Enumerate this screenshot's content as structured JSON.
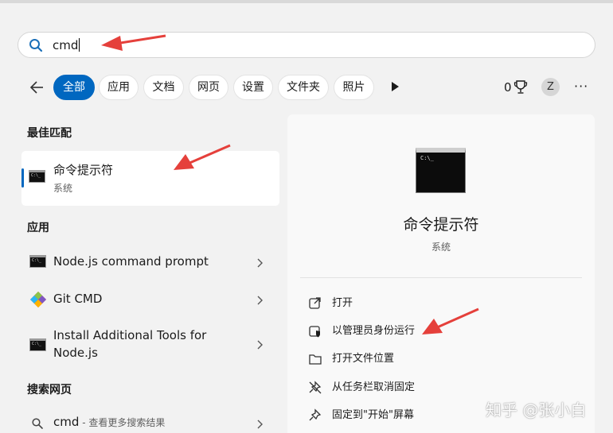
{
  "search": {
    "query": "cmd"
  },
  "filters": {
    "tabs": [
      {
        "label": "全部",
        "active": true
      },
      {
        "label": "应用",
        "active": false
      },
      {
        "label": "文档",
        "active": false
      },
      {
        "label": "网页",
        "active": false
      },
      {
        "label": "设置",
        "active": false
      },
      {
        "label": "文件夹",
        "active": false
      },
      {
        "label": "照片",
        "active": false
      }
    ],
    "points": "0",
    "avatar_initial": "Z",
    "more": "···"
  },
  "best_match": {
    "heading": "最佳匹配",
    "title": "命令提示符",
    "subtitle": "系统"
  },
  "apps": {
    "heading": "应用",
    "items": [
      {
        "label": "Node.js command prompt",
        "icon": "cmd-icon"
      },
      {
        "label": "Git CMD",
        "icon": "git-icon"
      },
      {
        "label": "Install Additional Tools for Node.js",
        "label_line1": "Install Additional Tools for",
        "label_line2": "Node.js",
        "icon": "cmd-icon"
      }
    ]
  },
  "web": {
    "heading": "搜索网页",
    "query": "cmd",
    "hint": " - 查看更多搜索结果"
  },
  "detail": {
    "title": "命令提示符",
    "subtitle": "系统",
    "actions": [
      {
        "label": "打开",
        "icon": "open-icon"
      },
      {
        "label": "以管理员身份运行",
        "icon": "shield-icon"
      },
      {
        "label": "打开文件位置",
        "icon": "folder-icon"
      },
      {
        "label": "从任务栏取消固定",
        "icon": "unpin-icon"
      },
      {
        "label": "固定到\"开始\"屏幕",
        "icon": "pin-icon"
      }
    ]
  },
  "watermark": "知乎 @张小白",
  "colors": {
    "accent": "#0067c0",
    "arrow": "#e5403b",
    "background": "#f2f2f2",
    "panel": "#f9f9f9"
  }
}
